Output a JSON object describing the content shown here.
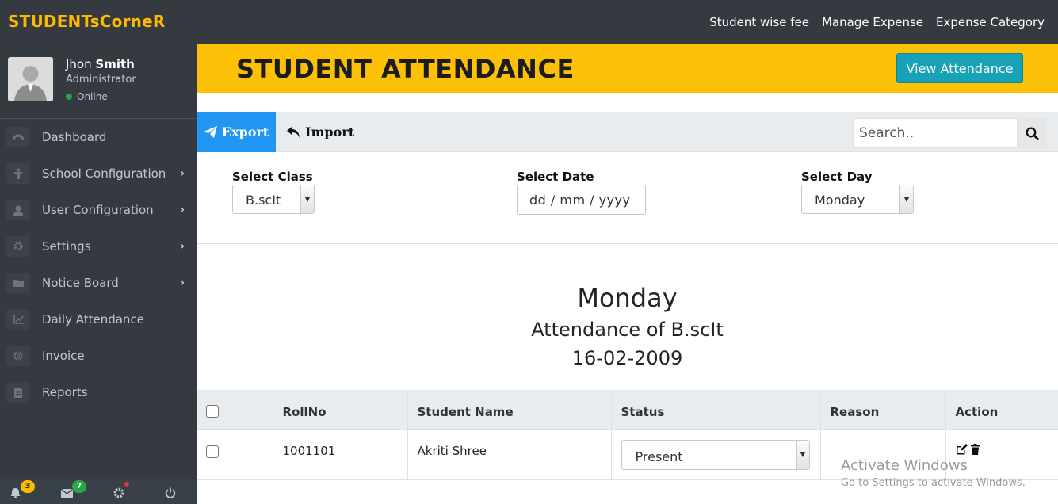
{
  "brand": "STUDENTsCorneR",
  "topnav": [
    "Student wise fee",
    "Manage Expense",
    "Expense Category"
  ],
  "user": {
    "first": "Jhon",
    "last": "Smith",
    "role": "Administrator",
    "status": "Online"
  },
  "menu": [
    {
      "label": "Dashboard",
      "icon": "dashboard-icon",
      "chevron": false
    },
    {
      "label": "School Configuration",
      "icon": "chalkboard-icon",
      "chevron": true
    },
    {
      "label": "User Configuration",
      "icon": "user-icon",
      "chevron": true
    },
    {
      "label": "Settings",
      "icon": "gear-icon",
      "chevron": true
    },
    {
      "label": "Notice Board",
      "icon": "folder-icon",
      "chevron": true
    },
    {
      "label": "Daily Attendance",
      "icon": "chart-icon",
      "chevron": false
    },
    {
      "label": "Invoice",
      "icon": "globe-icon",
      "chevron": false
    },
    {
      "label": "Reports",
      "icon": "file-icon",
      "chevron": false
    }
  ],
  "footer": {
    "notifications": "3",
    "messages": "7"
  },
  "page": {
    "title": "STUDENT ATTENDANCE",
    "view_button": "View Attendance"
  },
  "toolbar": {
    "export": "Export",
    "import": "Import",
    "search_placeholder": "Search.."
  },
  "filters": {
    "class_label": "Select Class",
    "class_value": "B.scIt",
    "date_label": "Select Date",
    "date_placeholder": "dd / mm / yyyy",
    "day_label": "Select Day",
    "day_value": "Monday"
  },
  "summary": {
    "day": "Monday",
    "attendance": "Attendance of B.scIt",
    "date": "16-02-2009"
  },
  "table": {
    "headers": [
      "RollNo",
      "Student Name",
      "Status",
      "Reason",
      "Action"
    ],
    "rows": [
      {
        "rollno": "1001101",
        "name": "Akriti Shree",
        "status": "Present",
        "reason": ""
      }
    ]
  },
  "watermark": {
    "line1": "Activate Windows",
    "line2": "Go to Settings to activate Windows."
  },
  "colors": {
    "accent": "#fcc107",
    "sidebar": "#343a40",
    "export": "#2196f3",
    "view": "#17a2b8"
  }
}
